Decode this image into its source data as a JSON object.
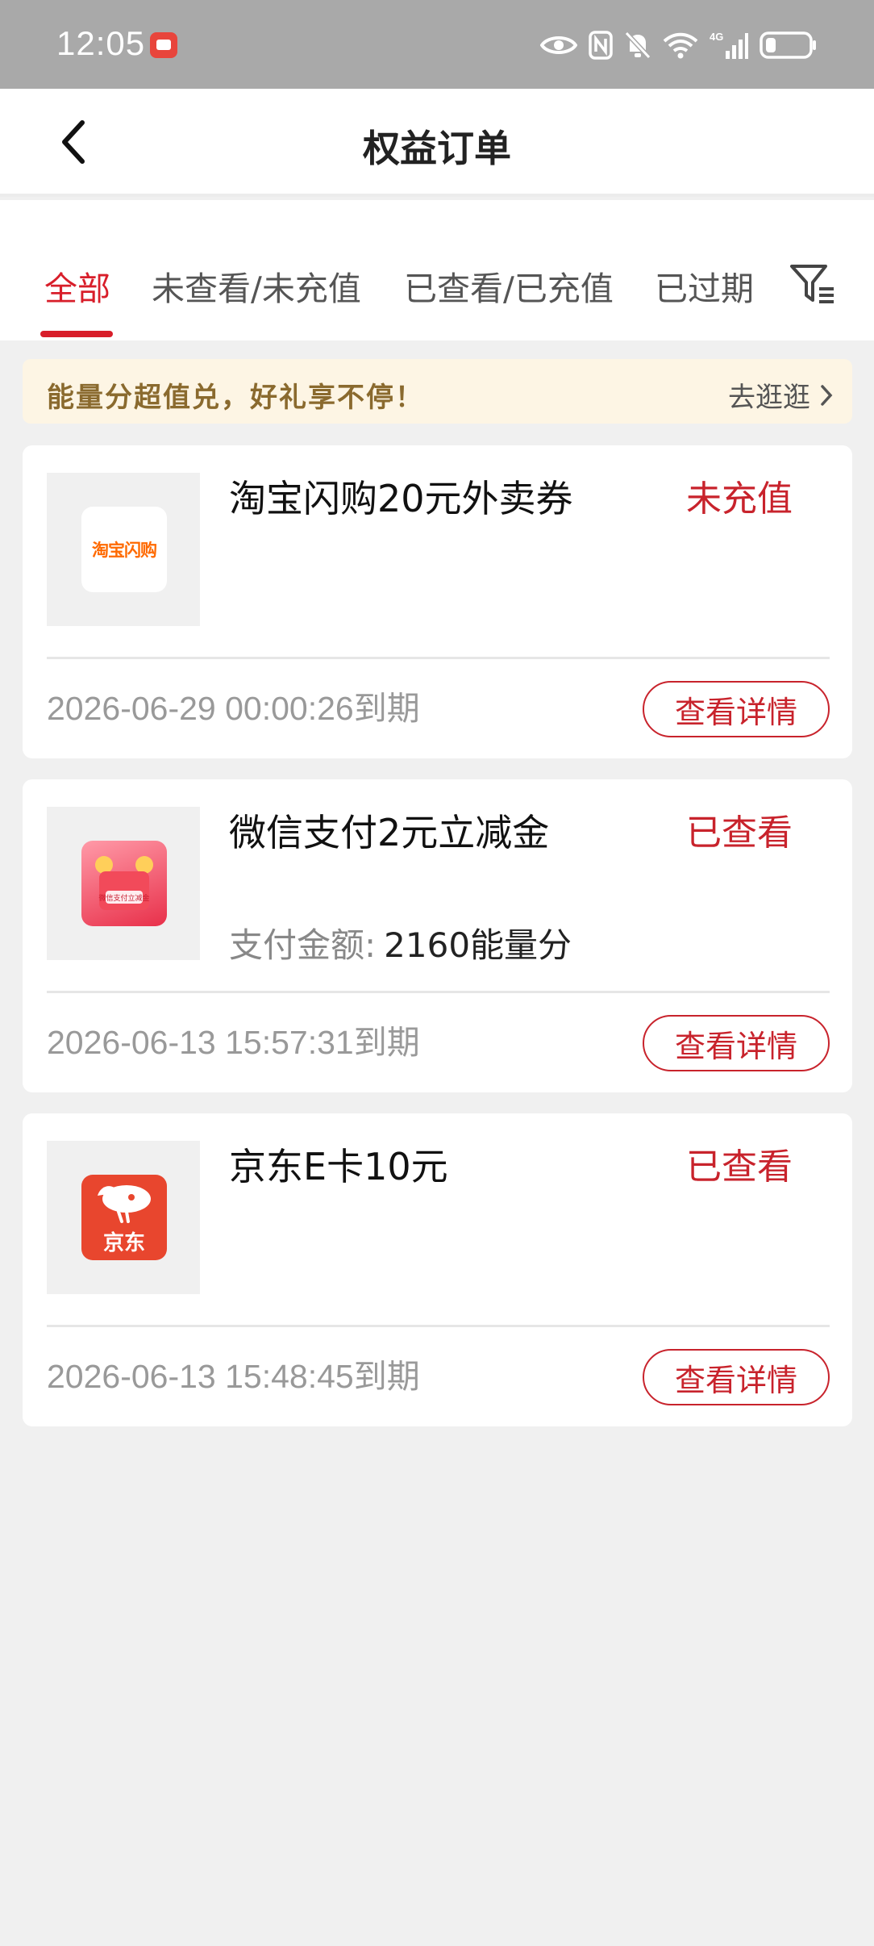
{
  "status_bar": {
    "time": "12:05",
    "network": "4G"
  },
  "header": {
    "title": "权益订单"
  },
  "tabs": [
    {
      "label": "全部",
      "active": true
    },
    {
      "label": "未查看/未充值",
      "active": false
    },
    {
      "label": "已查看/已充值",
      "active": false
    },
    {
      "label": "已过期",
      "active": false
    }
  ],
  "banner": {
    "text": "能量分超值兑，好礼享不停！",
    "link": "去逛逛"
  },
  "orders": [
    {
      "title": "淘宝闪购20元外卖券",
      "status": "未充值",
      "logo_text": "淘宝闪购",
      "payment_label": "",
      "payment_value": "",
      "expiry": "2026-06-29 00:00:26到期",
      "button": "查看详情"
    },
    {
      "title": "微信支付2元立减金",
      "status": "已查看",
      "logo_text": "微信支付立减金",
      "payment_label": "支付金额:",
      "payment_value": "2160能量分",
      "expiry": "2026-06-13 15:57:31到期",
      "button": "查看详情"
    },
    {
      "title": "京东E卡10元",
      "status": "已查看",
      "logo_text": "京东",
      "payment_label": "",
      "payment_value": "",
      "expiry": "2026-06-13 15:48:45到期",
      "button": "查看详情"
    }
  ],
  "colors": {
    "accent": "#d81e2a",
    "status_red": "#c8232c",
    "banner_bg": "#fdf5e4",
    "page_bg": "#f0f0f0"
  }
}
